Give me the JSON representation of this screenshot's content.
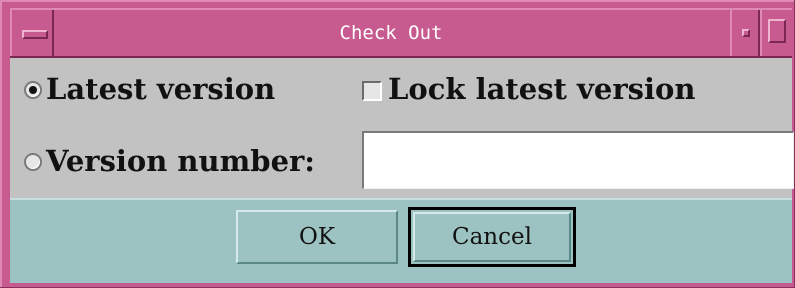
{
  "window": {
    "title": "Check Out"
  },
  "options": {
    "latest_version": {
      "label": "Latest version",
      "selected": true
    },
    "lock_latest_version": {
      "label": "Lock latest version",
      "checked": false
    },
    "version_number": {
      "label": "Version number:",
      "selected": false,
      "value": ""
    }
  },
  "buttons": {
    "ok_label": "OK",
    "cancel_label": "Cancel"
  },
  "colors": {
    "frame": "#c75a8f",
    "content_bg": "#c2c2c2",
    "button_area_bg": "#9cc3c1"
  },
  "icons": {
    "window_menu": "window-menu-icon",
    "minimize": "minimize-icon",
    "maximize": "maximize-icon"
  }
}
